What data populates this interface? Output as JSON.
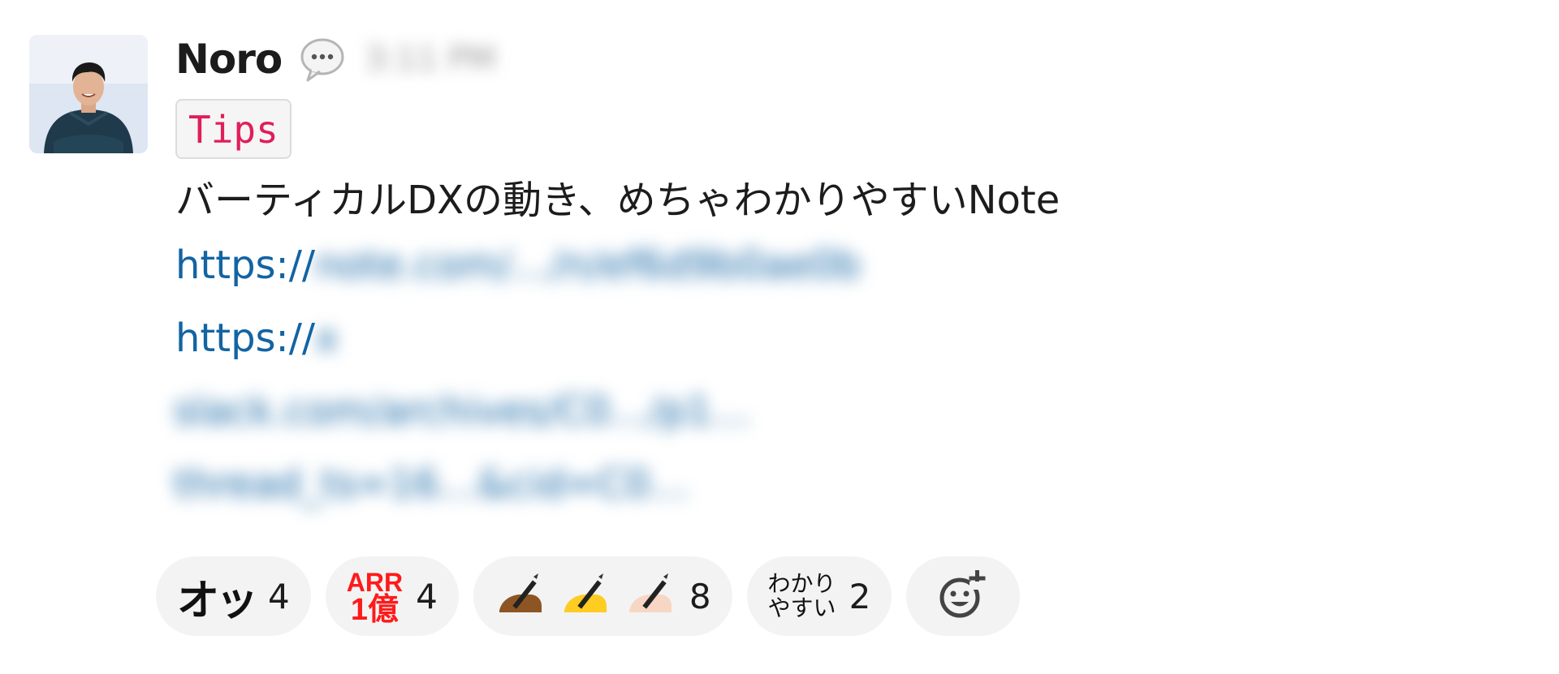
{
  "message": {
    "author": "Noro",
    "status_icon": "speech-bubble-icon",
    "timestamp": "3:11 PM",
    "tag": "Tips",
    "text": "バーティカルDXの動き、めちゃわかりやすいNote",
    "links": [
      {
        "prefix": "https://",
        "rest": "note.com/…/n/ef6d9b0ae0b"
      },
      {
        "prefix": "https://",
        "rest": "x"
      }
    ],
    "link_continued": [
      "slack.com/archives/C0…/p1…",
      "thread_ts=16…&cid=C0…"
    ]
  },
  "reactions": [
    {
      "emoji_text": "オッ",
      "count": "4",
      "name": "reaction-otsu"
    },
    {
      "emoji_text_l1": "ARR",
      "emoji_text_l2": "1億",
      "count": "4",
      "name": "reaction-arr-1oku"
    },
    {
      "emoji": "writing-hand-icon",
      "skin_tones": [
        "#8d5524",
        "#ffcc22",
        "#f7d7c4"
      ],
      "count": "8",
      "name": "reaction-writing-hand"
    },
    {
      "emoji_text_l1": "わかり",
      "emoji_text_l2": "やすい",
      "count": "2",
      "name": "reaction-wakariyasui"
    }
  ],
  "add_reaction_icon": "add-reaction-icon",
  "colors": {
    "link": "#1264a3",
    "tag_text": "#e01e5a",
    "reaction_bg": "#f3f3f3"
  }
}
